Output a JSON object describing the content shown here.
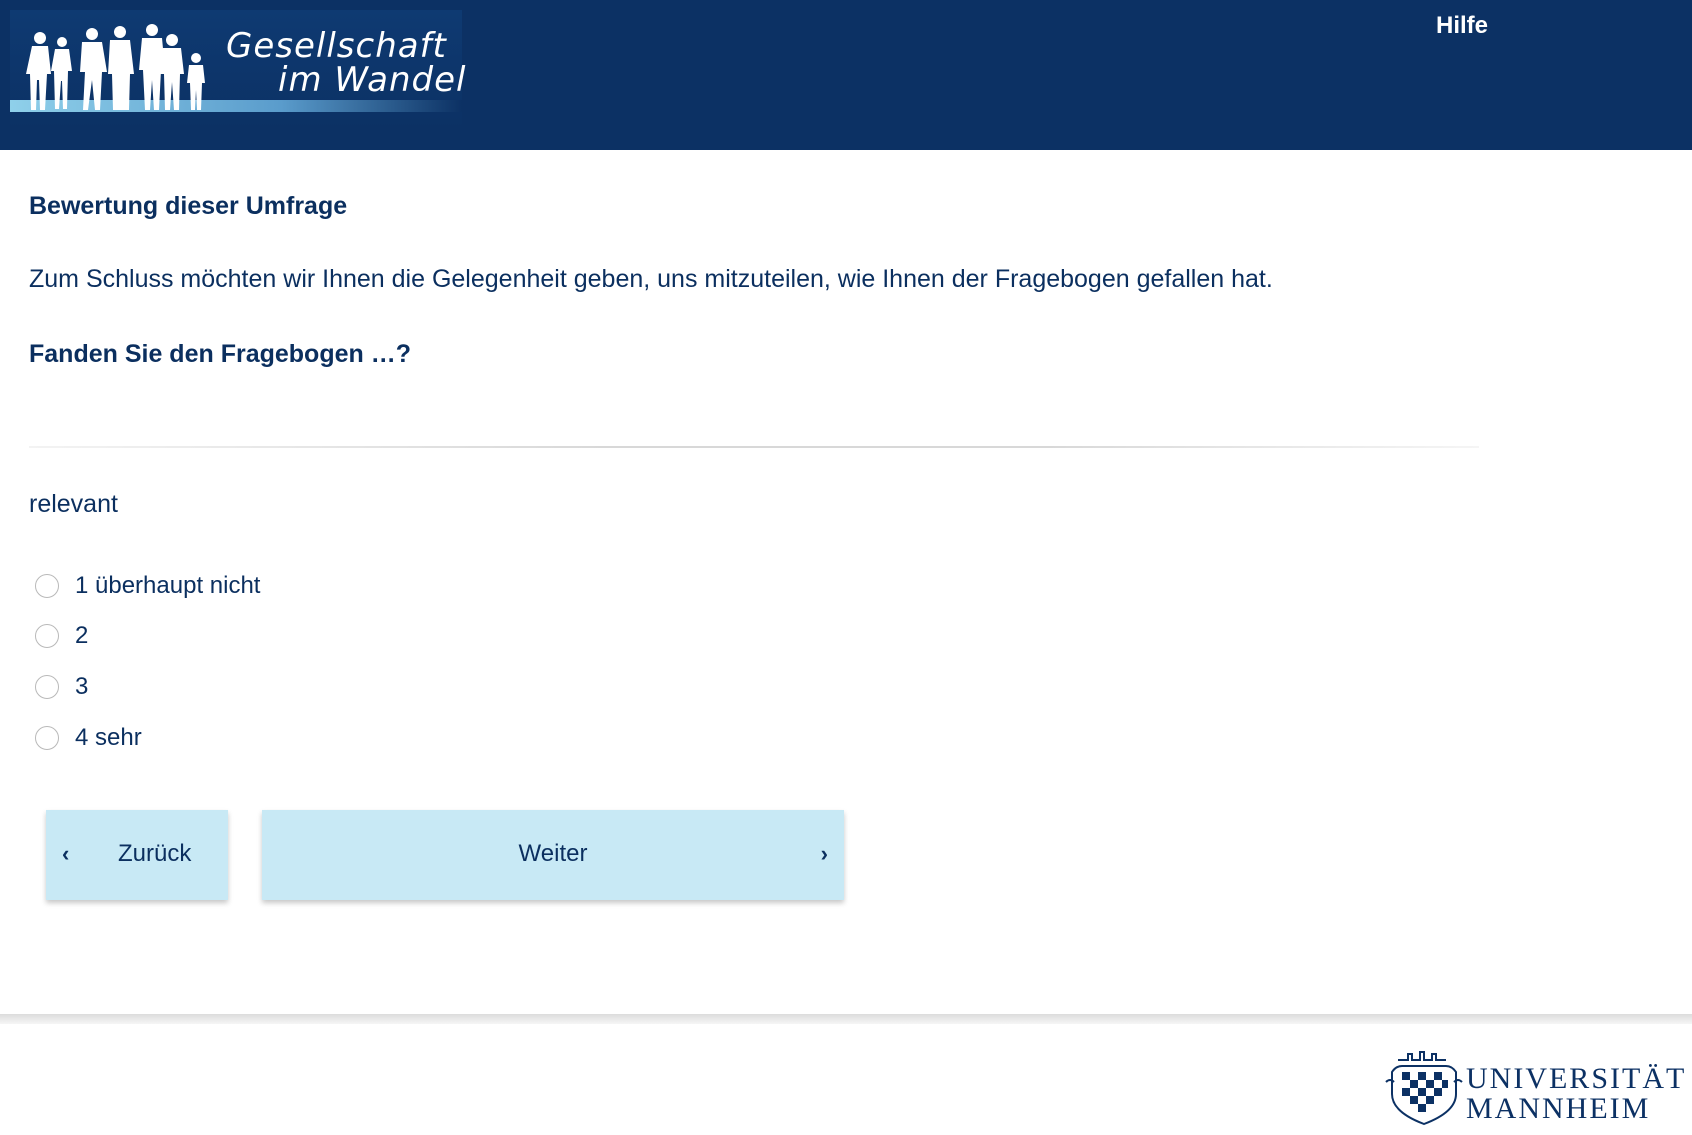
{
  "header": {
    "logo_line1": "Gesellschaft",
    "logo_line2": "im Wandel",
    "help_label": "Hilfe",
    "background_color": "#0c3164"
  },
  "survey": {
    "section_title": "Bewertung dieser Umfrage",
    "intro_text": "Zum Schluss möchten wir Ihnen die Gelegenheit geben, uns mitzuteilen, wie Ihnen der Fragebogen gefallen hat.",
    "question": "Fanden Sie den Fragebogen …?",
    "item_label": "relevant",
    "options": [
      {
        "label": "1 überhaupt nicht",
        "selected": false
      },
      {
        "label": "2",
        "selected": false
      },
      {
        "label": "3",
        "selected": false
      },
      {
        "label": "4 sehr",
        "selected": false
      }
    ]
  },
  "navigation": {
    "back_label": "Zurück",
    "next_label": "Weiter",
    "back_icon": "chevron-left-icon",
    "next_icon": "chevron-right-icon",
    "button_color": "#c8e9f5"
  },
  "footer": {
    "university_line1": "UNIVERSITÄT",
    "university_line2": "MANNHEIM"
  }
}
